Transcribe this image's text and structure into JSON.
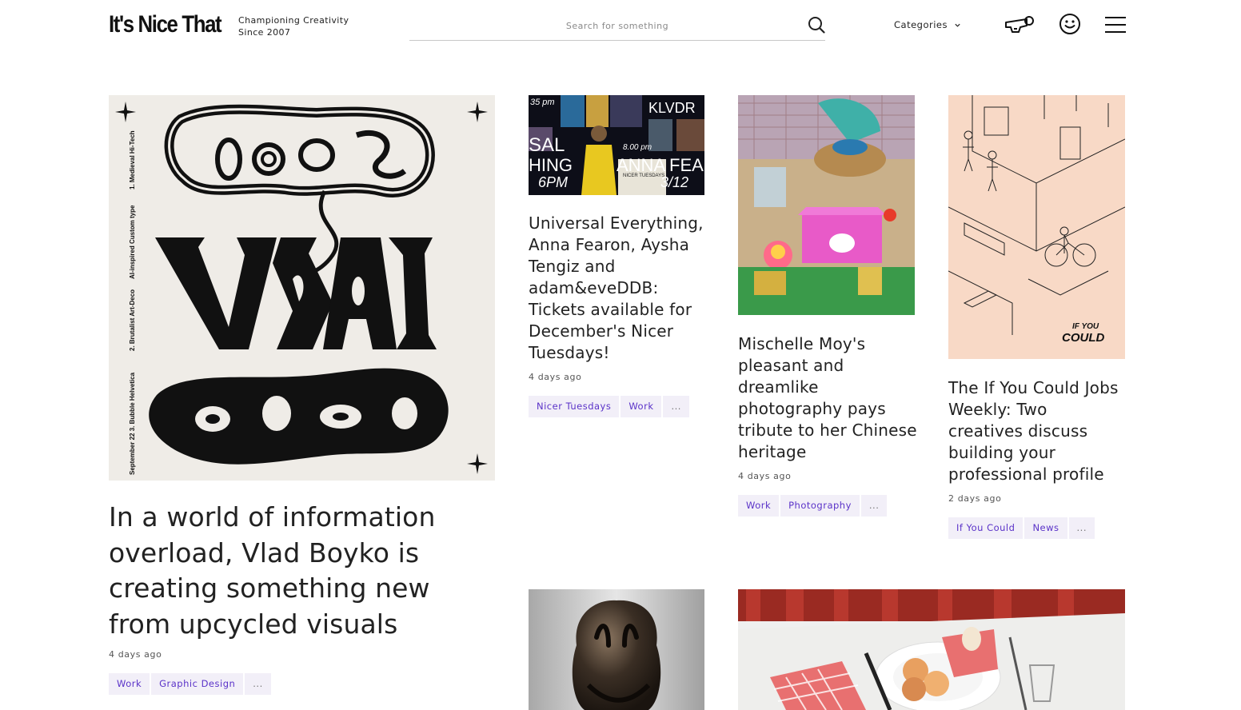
{
  "header": {
    "logo": "It's Nice That",
    "tagline_line1": "Championing Creativity",
    "tagline_line2": "Since 2007",
    "search_placeholder": "Search for something",
    "categories_label": "Categories"
  },
  "feature": {
    "title": "In a world of information overload, Vlad Boyko is creating something new from upcycled visuals",
    "date": "4 days ago",
    "tags": [
      "Work",
      "Graphic Design",
      "..."
    ],
    "poster_text": {
      "side_1": "1. Medieval Hi-Tech",
      "side_2": "AI-inspired Custom type",
      "side_3": "2. Brutalist Art-Deco",
      "side_4": "September 22 3. Bubble Helvetica"
    }
  },
  "cards": [
    {
      "title": "Universal Everything, Anna Fearon, Aysha Tengiz and adam&eveDDB: Tickets available for December's Nicer Tuesdays!",
      "date": "4 days ago",
      "tags": [
        "Nicer Tuesdays",
        "Work",
        "..."
      ],
      "screen_text": {
        "t1": "35 pm",
        "t2": "KLVDR",
        "t3": "SAL",
        "t4": "HING",
        "t5": "8.00 pm",
        "t6": "6PM",
        "t7": "ANNA FEA",
        "t8": "3/12",
        "t9": "NICER TUESDAYS"
      }
    },
    {
      "title": "Mischelle Moy's pleasant and dreamlike photography pays tribute to her Chinese heritage",
      "date": "4 days ago",
      "tags": [
        "Work",
        "Photography",
        "..."
      ]
    },
    {
      "title": "The If You Could Jobs Weekly: Two creatives discuss building your professional profile",
      "date": "2 days ago",
      "tags": [
        "If You Could",
        "News",
        "..."
      ],
      "illustration_text": {
        "line1": "IF YOU",
        "line2": "COULD"
      }
    }
  ],
  "colors": {
    "tag_bg": "#f2eff8",
    "tag_text": "#5a32c8",
    "poster_bg": "#efece7",
    "peach": "#f8d9c6"
  },
  "icons": [
    "search-icon",
    "chevron-down-icon",
    "whistle-icon",
    "smiley-icon",
    "hamburger-menu-icon"
  ]
}
